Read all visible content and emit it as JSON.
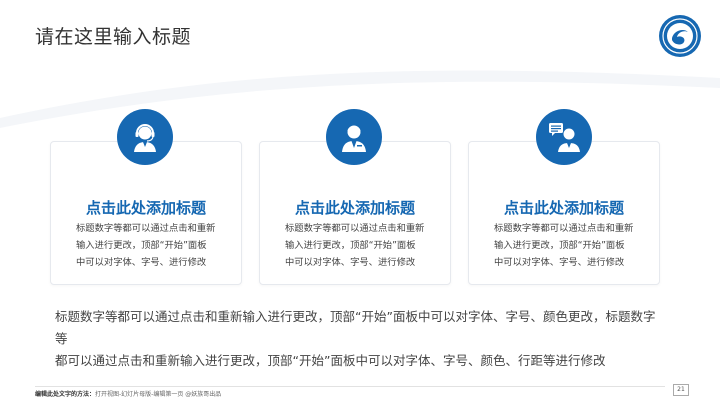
{
  "slide": {
    "title": "请在这里输入标题",
    "logo_icon": "school-emblem-icon"
  },
  "cards": [
    {
      "icon": "headset-agent-icon",
      "title": "点击此处添加标题",
      "lines": [
        "标题数字等都可以通过点击和重新",
        "输入进行更改，顶部“开始”面板",
        "中可以对字体、字号、进行修改"
      ]
    },
    {
      "icon": "person-icon",
      "title": "点击此处添加标题",
      "lines": [
        "标题数字等都可以通过点击和重新",
        "输入进行更改，顶部“开始”面板",
        "中可以对字体、字号、进行修改"
      ]
    },
    {
      "icon": "person-chat-icon",
      "title": "点击此处添加标题",
      "lines": [
        "标题数字等都可以通过点击和重新",
        "输入进行更改，顶部“开始”面板",
        "中可以对字体、字号、进行修改"
      ]
    }
  ],
  "body": {
    "lines": [
      "标题数字等都可以通过点击和重新输入进行更改，顶部“开始”面板中可以对字体、字号、颜色更改，标题数字等",
      "都可以通过点击和重新输入进行更改，顶部“开始”面板中可以对字体、字号、颜色、行距等进行修改"
    ]
  },
  "footer": {
    "label": "编辑此处文字的方法：",
    "hint": "打开视图-幻灯片母版-编辑第一页 @妖族哥出品",
    "page": "21"
  },
  "colors": {
    "accent": "#1668b2",
    "title_text": "#333333",
    "body_text": "#444444",
    "curve": "#f2f4f8"
  }
}
